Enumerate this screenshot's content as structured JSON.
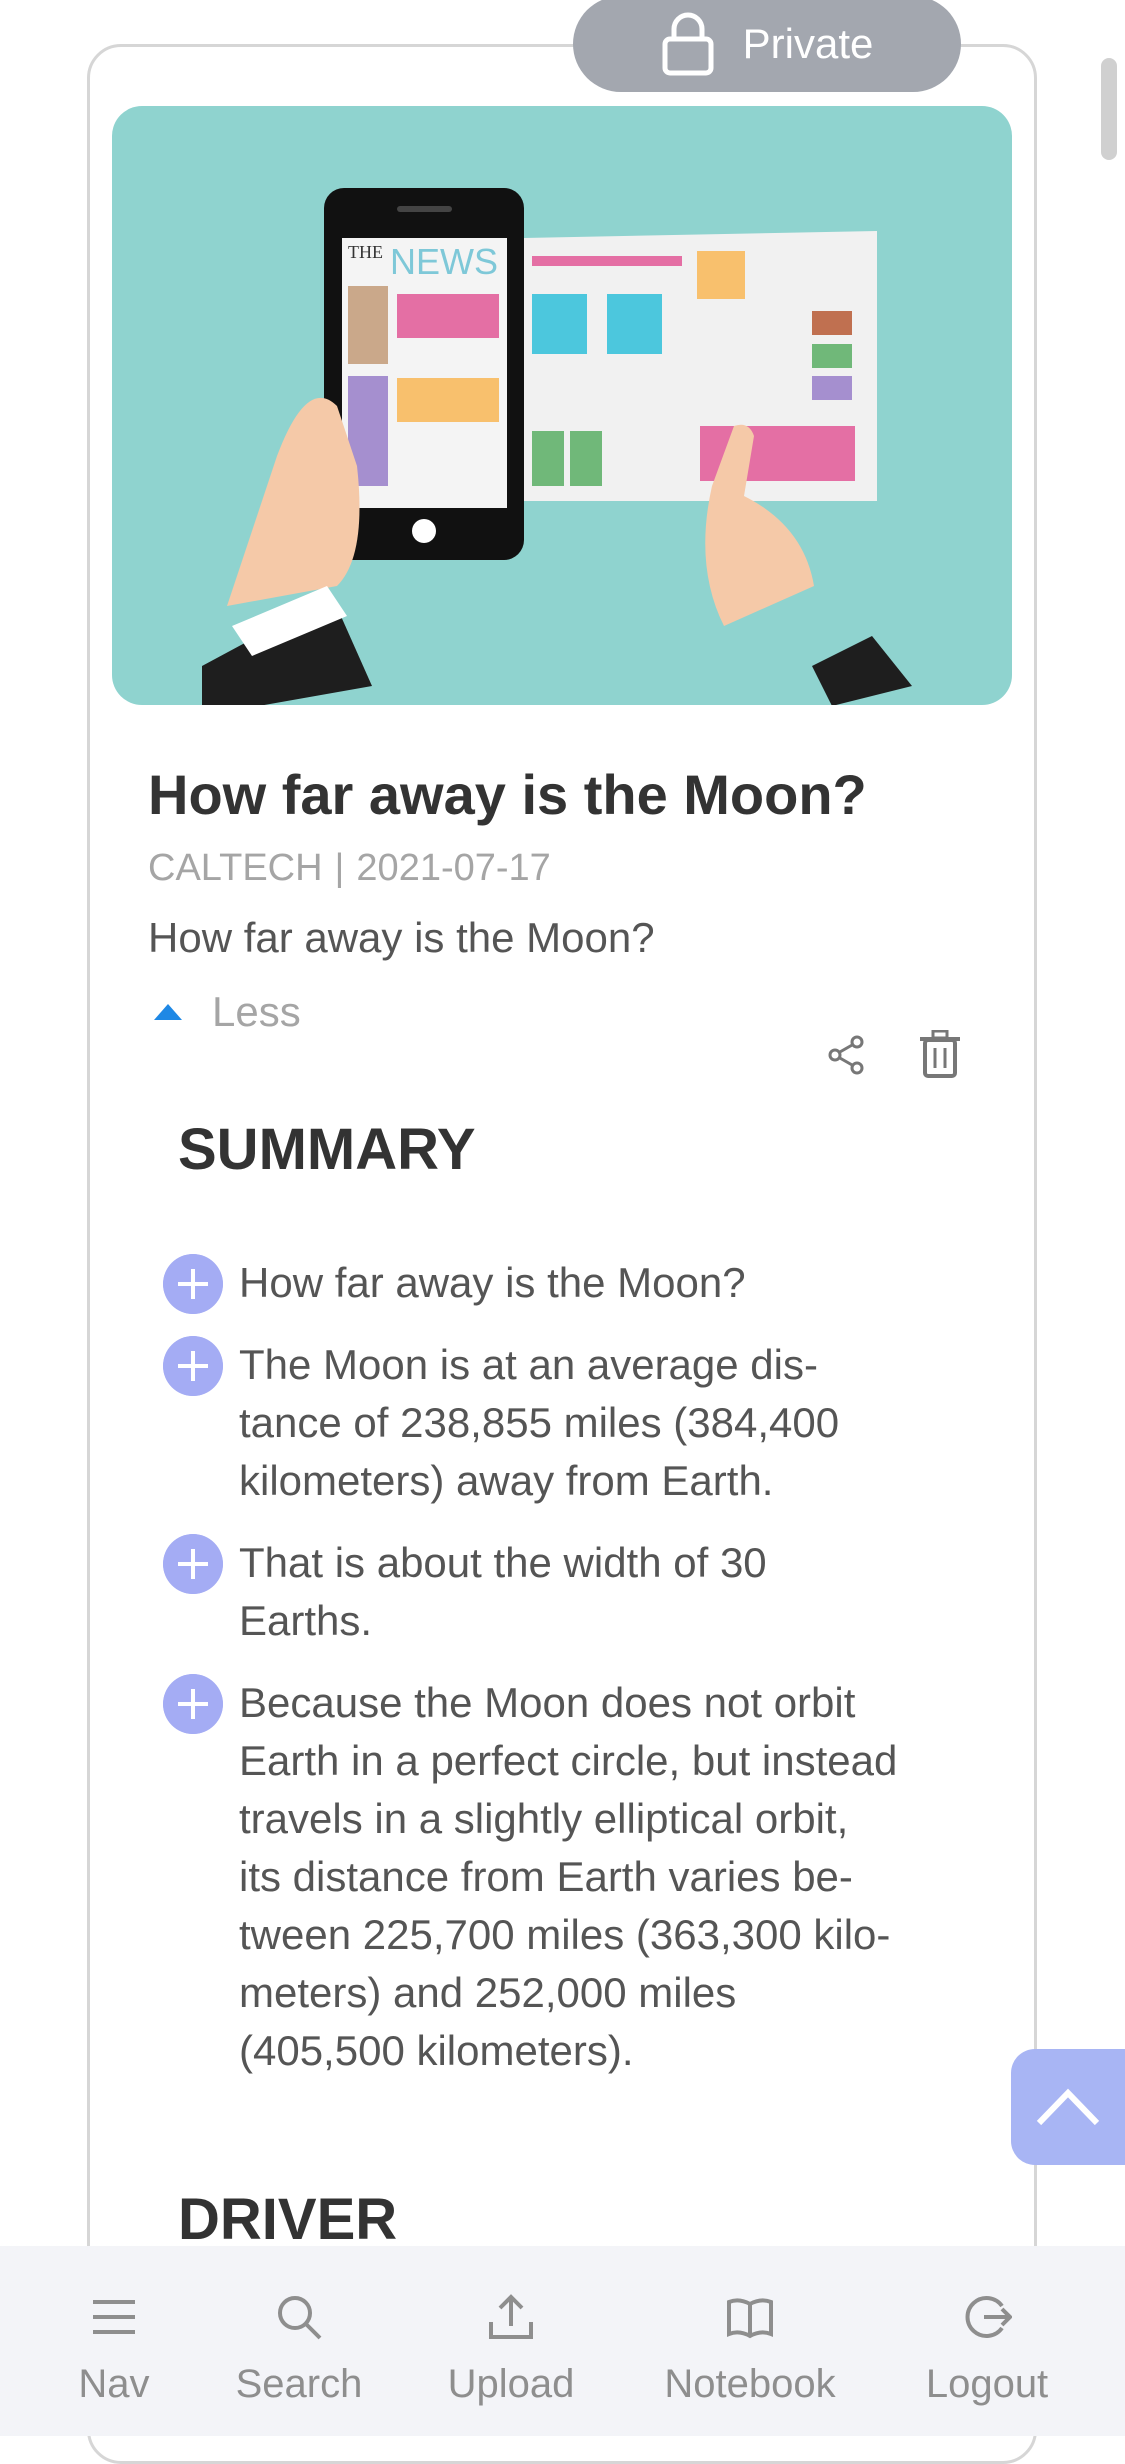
{
  "badge": {
    "label": "Private"
  },
  "article": {
    "title": "How far away is the Moon?",
    "source": "CALTECH",
    "separator": "|",
    "date": "2021-07-17",
    "description": "How far away is the Moon?",
    "toggle_label": "Less"
  },
  "summary": {
    "heading": "SUMMARY",
    "items": [
      {
        "text": "How far away is the Moon?"
      },
      {
        "text": "The Moon is at an average dis-\ntance of 238,855 miles (384,400\nkilometers) away from Earth."
      },
      {
        "text": "That is about the width of 30\nEarths."
      },
      {
        "text": "Because the Moon does not orbit\nEarth in a perfect circle, but instead\ntravels in a slightly elliptical orbit,\nits distance from Earth varies be-\ntween 225,700 miles (363,300 kilo-\nmeters) and 252,000 miles\n(405,500 kilometers)."
      }
    ]
  },
  "driver": {
    "heading": "DRIVER"
  },
  "hero_image": {
    "masthead_the": "THE",
    "masthead_news": "NEWS"
  },
  "bottom_nav": {
    "items": [
      {
        "label": "Nav",
        "icon": "menu-icon"
      },
      {
        "label": "Search",
        "icon": "search-icon"
      },
      {
        "label": "Upload",
        "icon": "upload-icon"
      },
      {
        "label": "Notebook",
        "icon": "book-icon"
      },
      {
        "label": "Logout",
        "icon": "logout-icon"
      }
    ]
  },
  "colors": {
    "accent": "#1e88e5",
    "badge": "#a3a7af",
    "plus": "#a4acf4",
    "scroll_top": "#a8b5f4",
    "hero_bg": "#8fd3cf"
  }
}
